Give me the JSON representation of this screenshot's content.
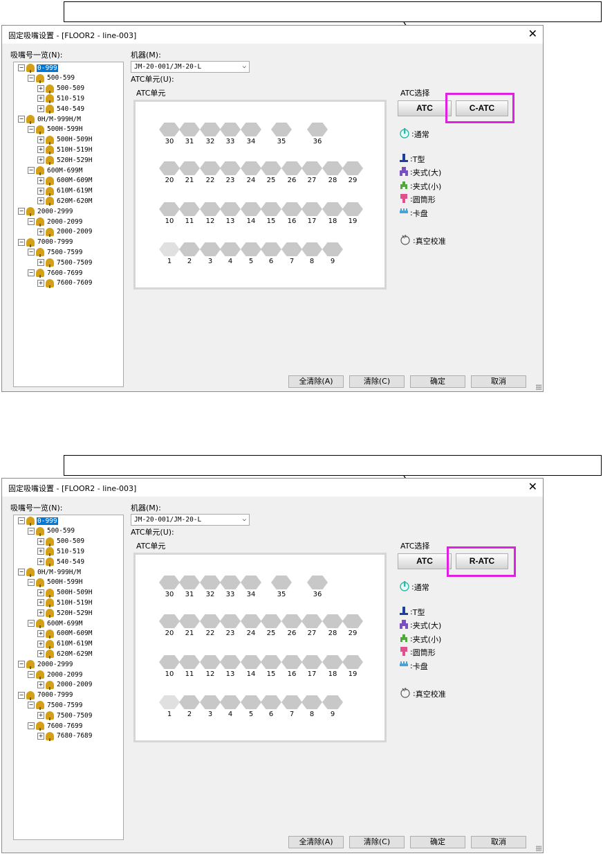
{
  "dialogs": [
    {
      "title": "固定吸嘴设置 - [FLOOR2 - line-003]",
      "nozzle_list_label": "吸嘴号一览(N):",
      "machine_label": "机器(M):",
      "machine_value": "JM-20-001/JM-20-L",
      "atc_unit_label": "ATC单元(U):",
      "atc_unit_panel_label": "ATC单元",
      "atc_select_label": "ATC选择",
      "atc_button": "ATC",
      "alt_atc_button": "C-ATC",
      "tree": [
        {
          "text": "0-999",
          "level": 0,
          "selected": true,
          "expanded": true
        },
        {
          "text": "500-599",
          "level": 1,
          "expanded": true
        },
        {
          "text": "500-509",
          "level": 2
        },
        {
          "text": "510-519",
          "level": 2
        },
        {
          "text": "540-549",
          "level": 2
        },
        {
          "text": "0H/M-999H/M",
          "level": 0,
          "expanded": true
        },
        {
          "text": "500H-599H",
          "level": 1,
          "expanded": true
        },
        {
          "text": "500H-509H",
          "level": 2
        },
        {
          "text": "510H-519H",
          "level": 2
        },
        {
          "text": "520H-529H",
          "level": 2
        },
        {
          "text": "600M-699M",
          "level": 1,
          "expanded": true
        },
        {
          "text": "600M-609M",
          "level": 2
        },
        {
          "text": "610M-619M",
          "level": 2
        },
        {
          "text": "620M-620M",
          "level": 2
        },
        {
          "text": "2000-2999",
          "level": 0,
          "expanded": true
        },
        {
          "text": "2000-2099",
          "level": 1,
          "expanded": true
        },
        {
          "text": "2000-2009",
          "level": 2
        },
        {
          "text": "7000-7999",
          "level": 0,
          "expanded": true
        },
        {
          "text": "7500-7599",
          "level": 1,
          "expanded": true
        },
        {
          "text": "7500-7509",
          "level": 2
        },
        {
          "text": "7600-7699",
          "level": 1,
          "expanded": true
        },
        {
          "text": "7600-7609",
          "level": 2
        }
      ],
      "legend": [
        "通常",
        "T型",
        "夹式(大)",
        "夹式(小)",
        "圆筒形",
        "卡盘",
        "真空校准"
      ],
      "buttons": [
        "全清除(A)",
        "清除(C)",
        "确定",
        "取消"
      ]
    },
    {
      "title": "固定吸嘴设置 - [FLOOR2 - line-003]",
      "nozzle_list_label": "吸嘴号一览(N):",
      "machine_label": "机器(M):",
      "machine_value": "JM-20-001/JM-20-L",
      "atc_unit_label": "ATC单元(U):",
      "atc_unit_panel_label": "ATC单元",
      "atc_select_label": "ATC选择",
      "atc_button": "ATC",
      "alt_atc_button": "R-ATC",
      "tree": [
        {
          "text": "0-999",
          "level": 0,
          "selected": true,
          "expanded": true
        },
        {
          "text": "500-599",
          "level": 1,
          "expanded": true
        },
        {
          "text": "500-509",
          "level": 2
        },
        {
          "text": "510-519",
          "level": 2
        },
        {
          "text": "540-549",
          "level": 2
        },
        {
          "text": "0H/M-999H/M",
          "level": 0,
          "expanded": true
        },
        {
          "text": "500H-599H",
          "level": 1,
          "expanded": true
        },
        {
          "text": "500H-509H",
          "level": 2
        },
        {
          "text": "510H-519H",
          "level": 2
        },
        {
          "text": "520H-529H",
          "level": 2
        },
        {
          "text": "600M-699M",
          "level": 1,
          "expanded": true
        },
        {
          "text": "600M-609M",
          "level": 2
        },
        {
          "text": "610M-619M",
          "level": 2
        },
        {
          "text": "620M-629M",
          "level": 2
        },
        {
          "text": "2000-2999",
          "level": 0,
          "expanded": true
        },
        {
          "text": "2000-2099",
          "level": 1,
          "expanded": true
        },
        {
          "text": "2000-2009",
          "level": 2
        },
        {
          "text": "7000-7999",
          "level": 0,
          "expanded": true
        },
        {
          "text": "7500-7599",
          "level": 1,
          "expanded": true
        },
        {
          "text": "7500-7509",
          "level": 2
        },
        {
          "text": "7600-7699",
          "level": 1,
          "expanded": true
        },
        {
          "text": "7680-7689",
          "level": 2
        }
      ],
      "legend": [
        "通常",
        "T型",
        "夹式(大)",
        "夹式(小)",
        "圆筒形",
        "卡盘",
        "真空校准"
      ],
      "buttons": [
        "全清除(A)",
        "清除(C)",
        "确定",
        "取消"
      ]
    }
  ],
  "atc_slots": {
    "row1": [
      "30",
      "31",
      "32",
      "33",
      "34",
      "35",
      "36"
    ],
    "row2": [
      "20",
      "21",
      "22",
      "23",
      "24",
      "25",
      "26",
      "27",
      "28",
      "29"
    ],
    "row3": [
      "10",
      "11",
      "12",
      "13",
      "14",
      "15",
      "16",
      "17",
      "18",
      "19"
    ],
    "row4": [
      "1",
      "2",
      "3",
      "4",
      "5",
      "6",
      "7",
      "8",
      "9"
    ]
  },
  "colors": {
    "highlight": "#e020e0",
    "selection": "#0078d7",
    "t_type": "#1f3f9f",
    "clamp_large": "#7a4fbf",
    "clamp_small": "#4fa83a",
    "cylinder": "#e0508a",
    "chuck": "#4aa3d8",
    "normal": "#2fb8a8"
  }
}
